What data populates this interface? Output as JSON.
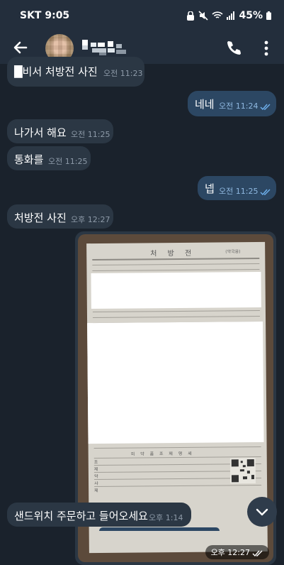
{
  "status": {
    "carrier_time": "SKT 9:05",
    "battery": "45%"
  },
  "header": {
    "contact_name_pixelated": "█▄█▀"
  },
  "messages": [
    {
      "dir": "in",
      "text": "█비서 처방전 사진",
      "time": "오전 11:23"
    },
    {
      "dir": "out",
      "text": "네네",
      "time": "오전 11:24"
    },
    {
      "dir": "in",
      "text": "나가서 해요",
      "time": "오전 11:25"
    },
    {
      "dir": "in",
      "text": "통화를",
      "time": "오전 11:25"
    },
    {
      "dir": "out",
      "text": "넵",
      "time": "오전 11:25"
    },
    {
      "dir": "in",
      "text": "처방전 사진",
      "time": "오후 12:27"
    },
    {
      "dir": "in",
      "text": "샌드위치 주문하고 들어오세요",
      "time": "오후 1:14"
    }
  ],
  "photo": {
    "time": "오후 12:27",
    "doc_title": "처 방 전",
    "doc_stamp": "(약국용)",
    "doc_table_title": "의 약 품 조 제 명 세",
    "doc_row_labels": [
      "조",
      "제",
      "약",
      "사",
      "제"
    ]
  },
  "colors": {
    "background": "#1a222c",
    "incoming": "#2b3744",
    "outgoing": "#2c4763",
    "read_check": "#6fb1ee"
  }
}
